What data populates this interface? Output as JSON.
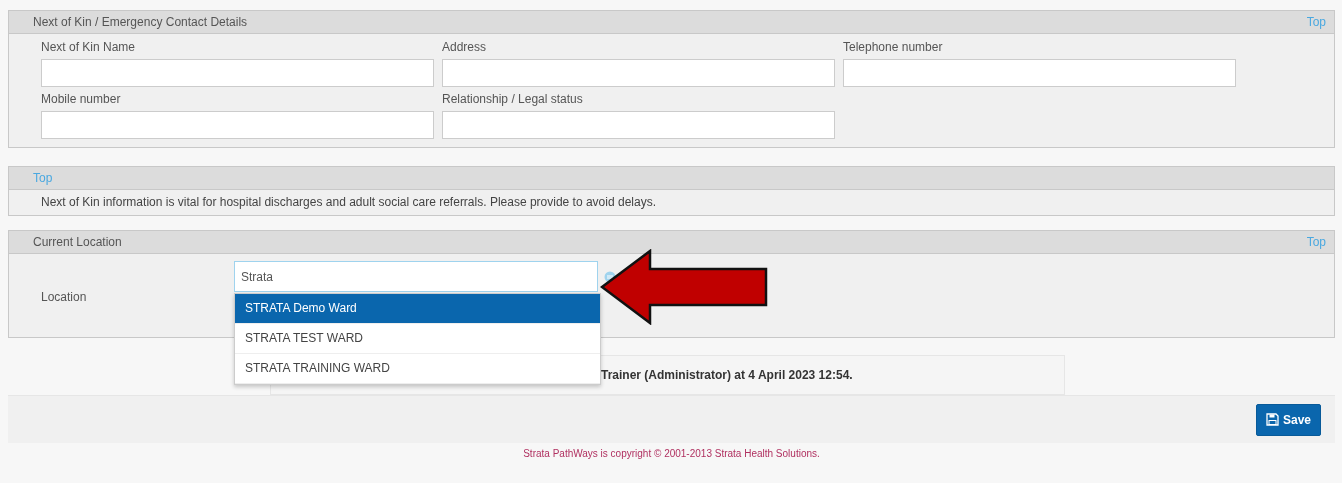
{
  "next_of_kin": {
    "title": "Next of Kin / Emergency Contact Details",
    "top_link": "Top",
    "fields": [
      {
        "label": "Next of Kin Name"
      },
      {
        "label": "Address"
      },
      {
        "label": "Telephone number"
      },
      {
        "label": "Mobile number"
      },
      {
        "label": "Relationship / Legal status"
      }
    ]
  },
  "notice": {
    "top_link": "Top",
    "text": "Next of Kin information is vital for hospital discharges and adult social care referrals. Please provide to avoid delays."
  },
  "current_location": {
    "title": "Current Location",
    "top_link": "Top",
    "location": {
      "label": "Location",
      "value": "Strata",
      "suggestions": [
        {
          "label": "STRATA Demo Ward",
          "selected": true
        },
        {
          "label": "STRATA TEST WARD",
          "selected": false
        },
        {
          "label": "STRATA TRAINING WARD",
          "selected": false
        }
      ]
    }
  },
  "audit": {
    "text": "Trainer (Administrator) at 4 April 2023 12:54."
  },
  "save_button": "Save",
  "footer": "Strata PathWays is copyright © 2001-2013 Strata Health Solutions."
}
